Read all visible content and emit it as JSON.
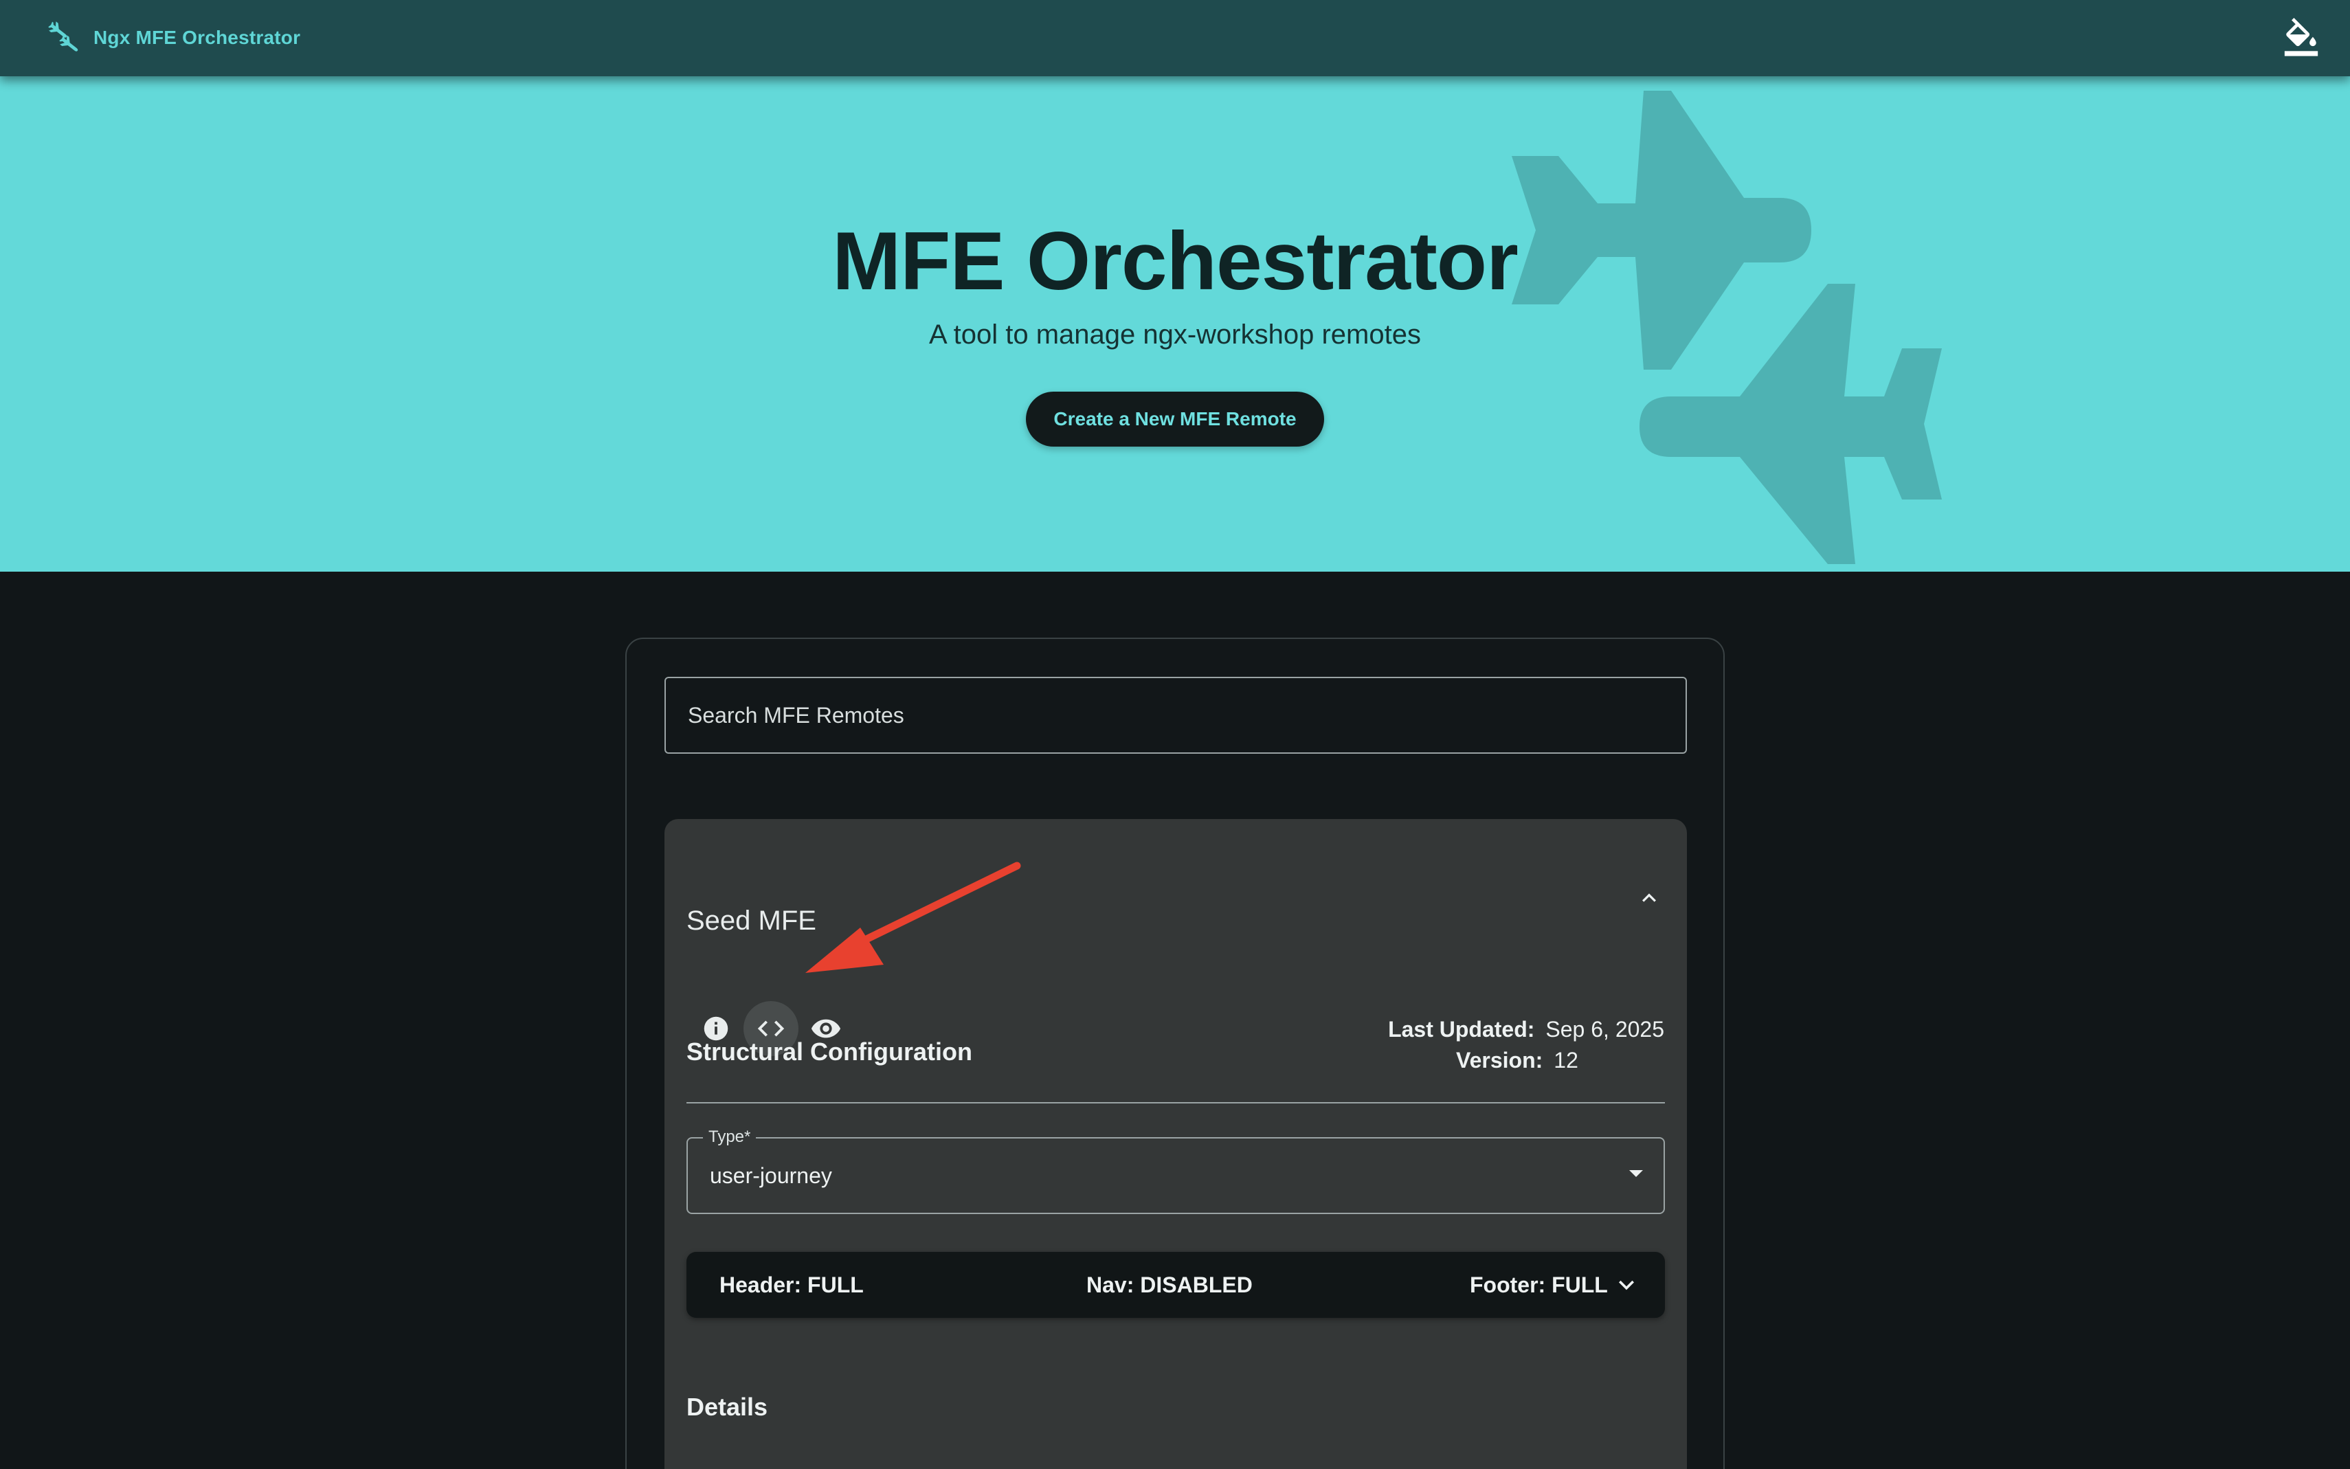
{
  "toolbar": {
    "brand_label": "Ngx MFE Orchestrator",
    "brand_icon": "flights-icon",
    "theme_icon": "format-color-fill-icon",
    "background_color": "#1f4b4e",
    "brand_color": "#5fd6d6"
  },
  "hero": {
    "title": "MFE Orchestrator",
    "subtitle": "A tool to manage ngx-workshop remotes",
    "cta_label": "Create a New MFE Remote",
    "background_color": "#63d9d9",
    "decoration_icon": "airplane-icon"
  },
  "search": {
    "placeholder": "Search MFE Remotes",
    "value": ""
  },
  "remote": {
    "name": "Seed MFE",
    "expanded": true,
    "actions": [
      {
        "name": "info-icon",
        "active": false
      },
      {
        "name": "code-icon",
        "active": true
      },
      {
        "name": "eye-icon",
        "active": false
      }
    ],
    "meta": {
      "last_updated_label": "Last Updated:",
      "last_updated_value": "Sep 6, 2025",
      "version_label": "Version:",
      "version_value": "12"
    },
    "structural": {
      "heading": "Structural Configuration",
      "type_label": "Type*",
      "type_value": "user-journey",
      "header": "Header: FULL",
      "nav": "Nav: DISABLED",
      "footer": "Footer: FULL"
    },
    "details_heading": "Details"
  },
  "annotation": {
    "arrow_color": "#e8412f",
    "points_to": "code-icon"
  }
}
